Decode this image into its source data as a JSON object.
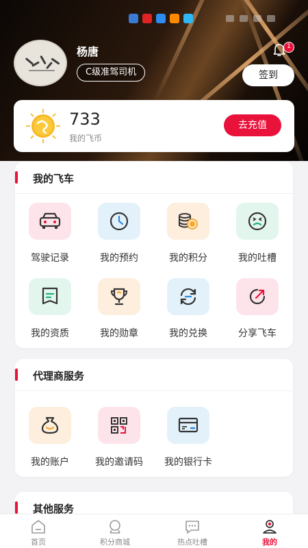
{
  "header": {
    "username": "杨唐",
    "level": "C级准驾司机",
    "notification_count": "1",
    "checkin_label": "签到"
  },
  "coins": {
    "value": "733",
    "label": "我的飞币",
    "recharge_label": "去充值"
  },
  "my_car": {
    "title": "我的飞车",
    "items": [
      {
        "label": "驾驶记录",
        "icon": "car-icon"
      },
      {
        "label": "我的预约",
        "icon": "clock-icon"
      },
      {
        "label": "我的积分",
        "icon": "coins-icon"
      },
      {
        "label": "我的吐槽",
        "icon": "grimace-face-icon"
      },
      {
        "label": "我的资质",
        "icon": "certificate-icon"
      },
      {
        "label": "我的勋章",
        "icon": "trophy-icon"
      },
      {
        "label": "我的兑换",
        "icon": "exchange-icon"
      },
      {
        "label": "分享飞车",
        "icon": "share-icon"
      }
    ]
  },
  "agent": {
    "title": "代理商服务",
    "items": [
      {
        "label": "我的账户",
        "icon": "money-bag-icon"
      },
      {
        "label": "我的邀请码",
        "icon": "qr-code-icon"
      },
      {
        "label": "我的银行卡",
        "icon": "bank-card-icon"
      }
    ]
  },
  "other": {
    "title": "其他服务"
  },
  "nav": {
    "items": [
      {
        "label": "首页",
        "icon": "home-icon"
      },
      {
        "label": "积分商城",
        "icon": "mall-icon"
      },
      {
        "label": "热点吐槽",
        "icon": "chat-icon"
      },
      {
        "label": "我的",
        "icon": "profile-icon"
      }
    ],
    "active_index": 3
  },
  "colors": {
    "accent": "#e8123a"
  }
}
